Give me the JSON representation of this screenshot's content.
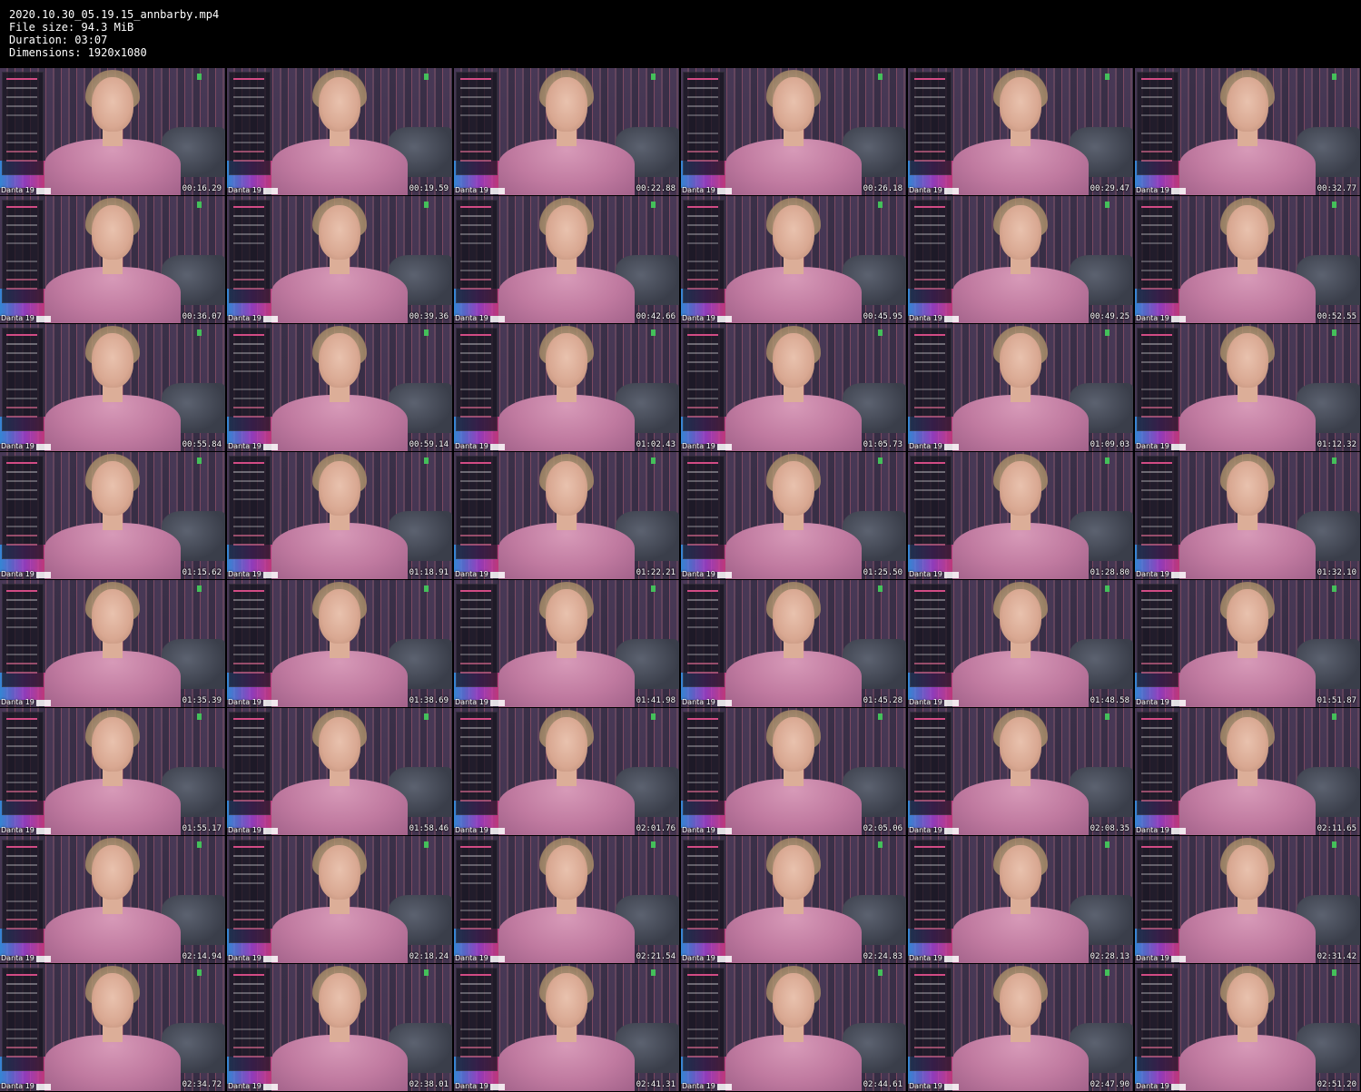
{
  "header": {
    "filename": "2020.10.30_05.19.15_annbarby.mp4",
    "file_size": "File size: 94.3 MiB",
    "duration": "Duration: 03:07",
    "dimensions": "Dimensions: 1920x1080"
  },
  "thumbnail_label": "Danta 19",
  "timestamps": [
    "00:16.29",
    "00:19.59",
    "00:22.88",
    "00:26.18",
    "00:29.47",
    "00:32.77",
    "00:36.07",
    "00:39.36",
    "00:42.66",
    "00:45.95",
    "00:49.25",
    "00:52.55",
    "00:55.84",
    "00:59.14",
    "01:02.43",
    "01:05.73",
    "01:09.03",
    "01:12.32",
    "01:15.62",
    "01:18.91",
    "01:22.21",
    "01:25.50",
    "01:28.80",
    "01:32.10",
    "01:35.39",
    "01:38.69",
    "01:41.98",
    "01:45.28",
    "01:48.58",
    "01:51.87",
    "01:55.17",
    "01:58.46",
    "02:01.76",
    "02:05.06",
    "02:08.35",
    "02:11.65",
    "02:14.94",
    "02:18.24",
    "02:21.54",
    "02:24.83",
    "02:28.13",
    "02:31.42",
    "02:34.72",
    "02:38.01",
    "02:41.31",
    "02:44.61",
    "02:47.90",
    "02:51.20"
  ],
  "colors": {
    "background": "#000000",
    "text": "#ffffff",
    "dress": "#c07aa0",
    "accent": "#d24b84"
  }
}
